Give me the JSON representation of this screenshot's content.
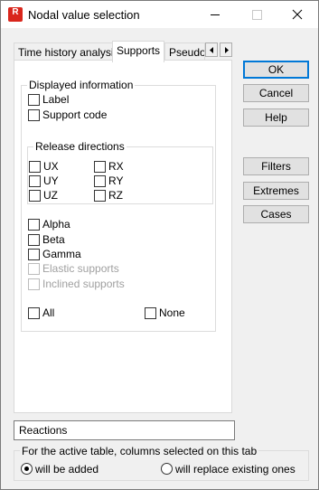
{
  "window": {
    "title": "Nodal value selection",
    "app_icon_letter": "R"
  },
  "tabs": [
    {
      "label": "Time history analysis",
      "active": false
    },
    {
      "label": "Supports",
      "active": true
    },
    {
      "label": "Pseudos",
      "active": false
    }
  ],
  "displayed_information": {
    "title": "Displayed information",
    "items": [
      {
        "label": "Label",
        "checked": false
      },
      {
        "label": "Support code",
        "checked": false
      }
    ]
  },
  "release_directions": {
    "title": "Release directions",
    "items": [
      "UX",
      "RX",
      "UY",
      "RY",
      "UZ",
      "RZ"
    ]
  },
  "stiffness": {
    "items": [
      {
        "label": "Alpha",
        "enabled": true
      },
      {
        "label": "Beta",
        "enabled": true
      },
      {
        "label": "Gamma",
        "enabled": true
      },
      {
        "label": "Elastic supports",
        "enabled": false
      },
      {
        "label": "Inclined supports",
        "enabled": false
      }
    ]
  },
  "select_all": {
    "all_label": "All",
    "none_label": "None"
  },
  "buttons": {
    "ok": "OK",
    "cancel": "Cancel",
    "help": "Help",
    "filters": "Filters",
    "extremes": "Extremes",
    "cases": "Cases"
  },
  "reactions_field": {
    "value": "Reactions"
  },
  "columns_group": {
    "title": "For the active table, columns selected on this tab",
    "options": [
      {
        "label": "will be added",
        "checked": true
      },
      {
        "label": "will replace existing ones",
        "checked": false
      }
    ]
  }
}
